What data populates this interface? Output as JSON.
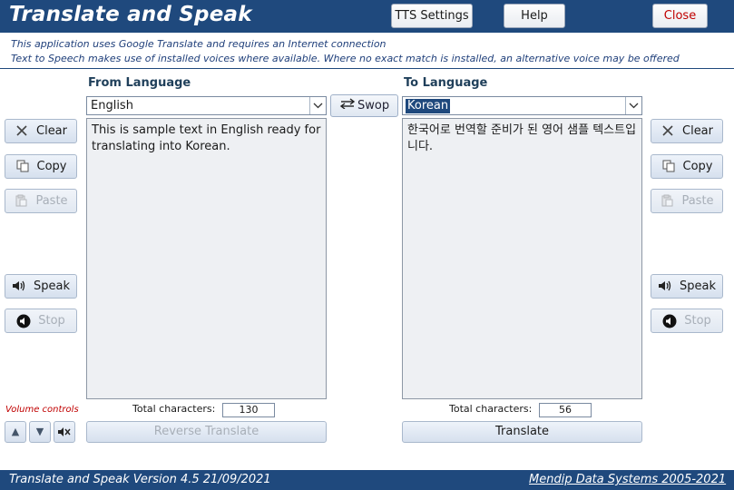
{
  "header": {
    "title": "Translate and Speak",
    "tts_settings_label": "TTS Settings",
    "help_label": "Help",
    "close_label": "Close"
  },
  "info": {
    "line1": "This application uses Google Translate and requires an Internet connection",
    "line2": "Text to Speech makes use of installed voices where available. Where no exact match is installed, an alternative voice may be offered"
  },
  "from": {
    "label": "From Language",
    "language": "English",
    "text": "This is sample text in English ready for translating into Korean.",
    "total_label": "Total characters:",
    "total": "130"
  },
  "to": {
    "label": "To Language",
    "language": "Korean",
    "text": "한국어로 번역할 준비가 된 영어 샘플 텍스트입니다.",
    "total_label": "Total characters:",
    "total": "56"
  },
  "buttons": {
    "swop": "Swop",
    "clear": "Clear",
    "copy": "Copy",
    "paste": "Paste",
    "speak": "Speak",
    "stop": "Stop",
    "reverse_translate": "Reverse Translate",
    "translate": "Translate"
  },
  "volume": {
    "label": "Volume controls"
  },
  "footer": {
    "version": "Translate and Speak   Version 4.5   21/09/2021",
    "company": "Mendip Data Systems 2005-2021"
  },
  "icons": {
    "clear": "x-icon",
    "copy": "copy-icon",
    "paste": "paste-icon",
    "speak": "speaker-icon",
    "stop": "stop-icon",
    "swop": "swap-arrows-icon",
    "dropdown": "chevron-down-icon",
    "volume_up": "volume-up-icon",
    "volume_down": "volume-down-icon",
    "mute": "mute-icon"
  },
  "colors": {
    "brand": "#1f497d",
    "close_text": "#c00000",
    "volume_label": "#c00000"
  }
}
